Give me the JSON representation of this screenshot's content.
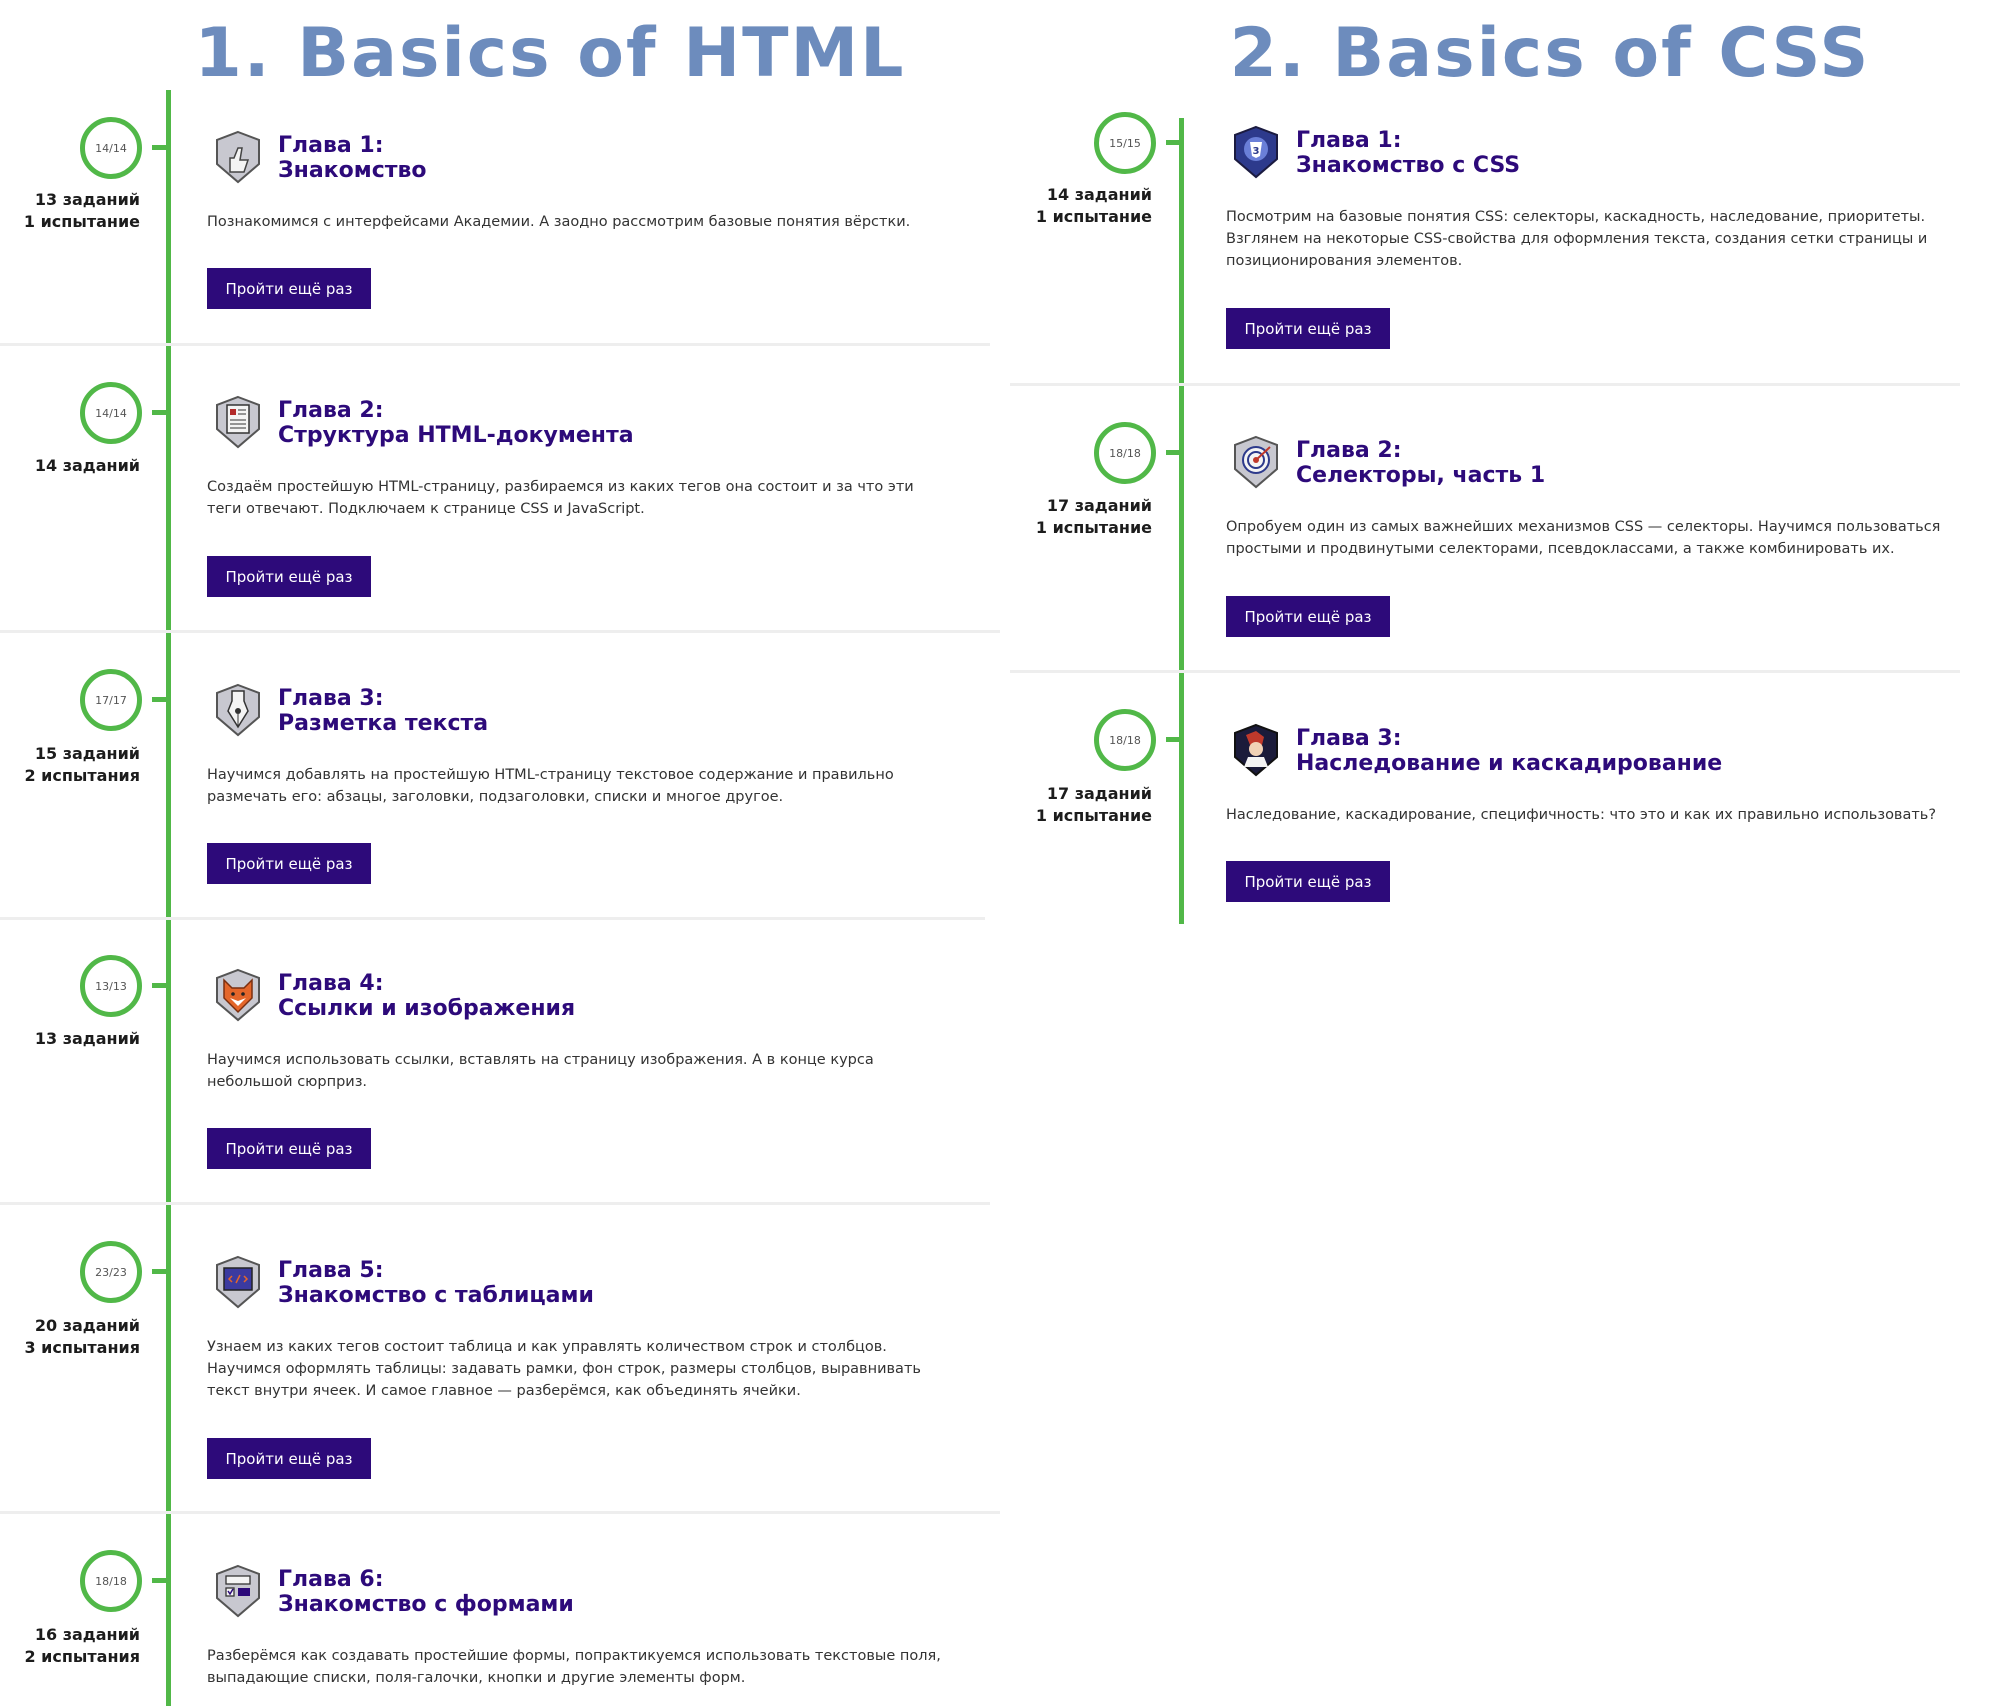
{
  "courses": [
    {
      "title": "1. Basics of HTML",
      "chapters": [
        {
          "progress": "14/14",
          "tasks": "13 заданий",
          "trials": "1 испытание",
          "label": "Глава 1:",
          "name": "Знакомство",
          "description": "Познакомимся с интерфейсами Академии. А заодно рассмотрим базовые понятия вёрстки.",
          "button": "Пройти ещё раз",
          "badge_icon": "thumbs-up-icon"
        },
        {
          "progress": "14/14",
          "tasks": "14 заданий",
          "label": "Глава 2:",
          "name": "Структура HTML-документа",
          "description": "Создаём простейшую HTML-страницу, разбираемся из каких тегов она состоит и за что эти теги отвечают. Подключаем к странице CSS и JavaScript.",
          "button": "Пройти ещё раз",
          "badge_icon": "document-icon"
        },
        {
          "progress": "17/17",
          "tasks": "15 заданий",
          "trials": "2 испытания",
          "label": "Глава 3:",
          "name": "Разметка текста",
          "description": "Научимся добавлять на простейшую HTML-страницу текстовое содержание и правильно размечать его: абзацы, заголовки, подзаголовки, списки и многое другое.",
          "button": "Пройти ещё раз",
          "badge_icon": "pen-nib-icon"
        },
        {
          "progress": "13/13",
          "tasks": "13 заданий",
          "label": "Глава 4:",
          "name": "Ссылки и изображения",
          "description": "Научимся использовать ссылки, вставлять на страницу изображения. А в конце курса небольшой сюрприз.",
          "button": "Пройти ещё раз",
          "badge_icon": "fox-icon"
        },
        {
          "progress": "23/23",
          "tasks": "20 заданий",
          "trials": "3 испытания",
          "label": "Глава 5:",
          "name": "Знакомство с таблицами",
          "description": "Узнаем из каких тегов состоит таблица и как управлять количеством строк и столбцов. Научимся оформлять таблицы: задавать рамки, фон строк, размеры столбцов, выравнивать текст внутри ячеек. И самое главное — разберёмся, как объединять ячейки.",
          "button": "Пройти ещё раз",
          "badge_icon": "code-screen-icon"
        },
        {
          "progress": "18/18",
          "tasks": "16 заданий",
          "trials": "2 испытания",
          "label": "Глава 6:",
          "name": "Знакомство с формами",
          "description": "Разберёмся как создавать простейшие формы, попрактикуемся использовать текстовые поля, выпадающие списки, поля-галочки, кнопки и другие элементы форм.",
          "badge_icon": "form-icon"
        }
      ]
    },
    {
      "title": "2. Basics of CSS",
      "chapters": [
        {
          "progress": "15/15",
          "tasks": "14 заданий",
          "trials": "1 испытание",
          "label": "Глава 1:",
          "name": "Знакомство с CSS",
          "description": "Посмотрим на базовые понятия CSS: селекторы, каскадность, наследование, приоритеты. Взглянем на некоторые CSS-свойства для оформления текста, создания сетки страницы и позиционирования элементов.",
          "button": "Пройти ещё раз",
          "badge_icon": "css3-icon"
        },
        {
          "progress": "18/18",
          "tasks": "17 заданий",
          "trials": "1 испытание",
          "label": "Глава 2:",
          "name": "Селекторы, часть 1",
          "description": "Опробуем один из самых важнейших механизмов CSS — селекторы. Научимся пользоваться простыми и продвинутыми селекторами, псевдоклассами, а также комбинировать их.",
          "button": "Пройти ещё раз",
          "badge_icon": "target-icon"
        },
        {
          "progress": "18/18",
          "tasks": "17 заданий",
          "trials": "1 испытание",
          "label": "Глава 3:",
          "name": "Наследование и каскадирование",
          "description": "Наследование, каскадирование, специфичность: что это и как их правильно использовать?",
          "button": "Пройти ещё раз",
          "badge_icon": "portrait-icon"
        }
      ]
    }
  ],
  "colors": {
    "accent": "#2d0a7a",
    "timeline": "#51b848",
    "course_title": "#6d8cbd"
  }
}
